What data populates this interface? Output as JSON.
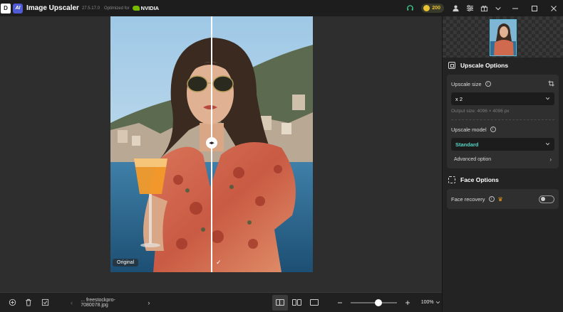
{
  "titlebar": {
    "logo_letter": "D",
    "ai_badge": "AI",
    "app_name": "Image Upscaler",
    "version": "27.5.17.0",
    "optimized_text": "Optimized for",
    "partner": "NVIDIA",
    "credits": "200"
  },
  "canvas": {
    "original_label": "Original"
  },
  "bottombar": {
    "filename": "... freestockpro-7080078.jpg",
    "zoom_value": "100%",
    "zoom_fraction": 0.6
  },
  "upscale_options": {
    "title": "Upscale Options",
    "size_label": "Upscale size",
    "size_value": "x 2",
    "output_size": "Output size: 4096 × 4096 px",
    "model_label": "Upscale model",
    "model_value": "Standard",
    "advanced_label": "Advanced option"
  },
  "face_options": {
    "title": "Face Options",
    "recovery_label": "Face recovery",
    "recovery_enabled": false
  },
  "colors": {
    "accent_teal": "#57d3c5",
    "coin_gold": "#e7c233",
    "nvidia_green": "#76b900"
  }
}
